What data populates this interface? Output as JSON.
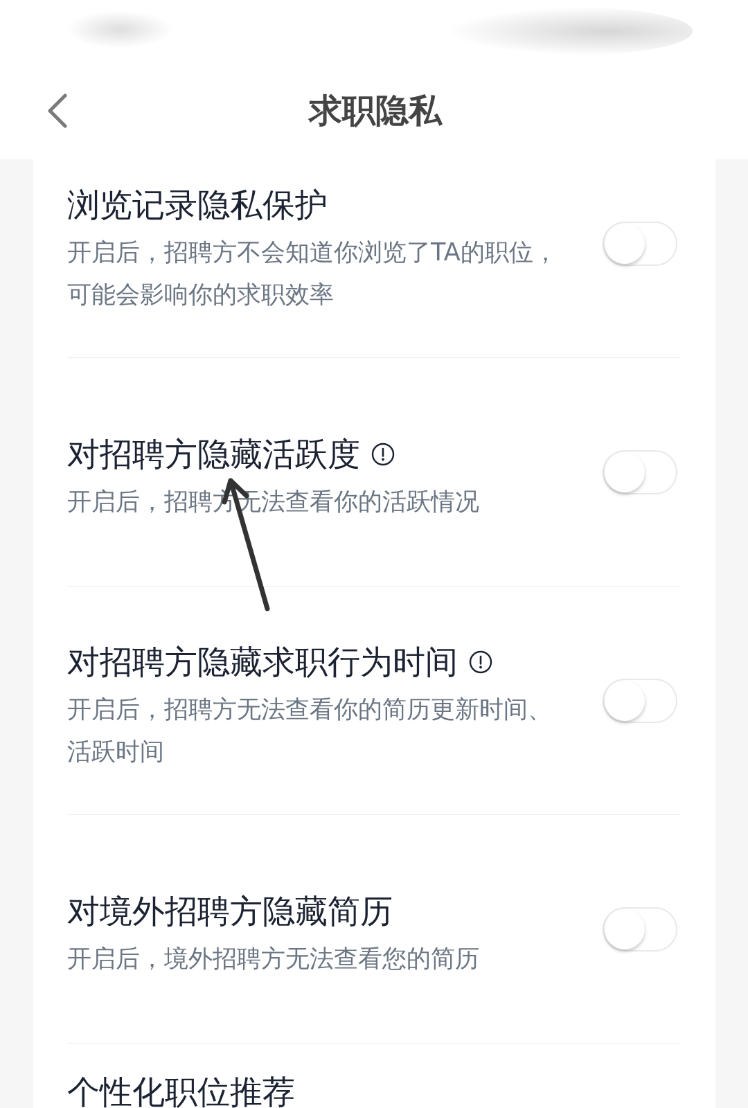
{
  "header": {
    "title": "求职隐私"
  },
  "settings": [
    {
      "title": "浏览记录隐私保护",
      "info": false,
      "description": "开启后，招聘方不会知道你浏览了TA的职位，可能会影响你的求职效率",
      "on": false
    },
    {
      "title": "对招聘方隐藏活跃度",
      "info": true,
      "description": "开启后，招聘方无法查看你的活跃情况",
      "on": false
    },
    {
      "title": "对招聘方隐藏求职行为时间",
      "info": true,
      "description": "开启后，招聘方无法查看你的简历更新时间、活跃时间",
      "on": false
    },
    {
      "title": "对境外招聘方隐藏简历",
      "info": false,
      "description": "开启后，境外招聘方无法查看您的简历",
      "on": false
    },
    {
      "title": "个性化职位推荐",
      "info": false
    }
  ]
}
